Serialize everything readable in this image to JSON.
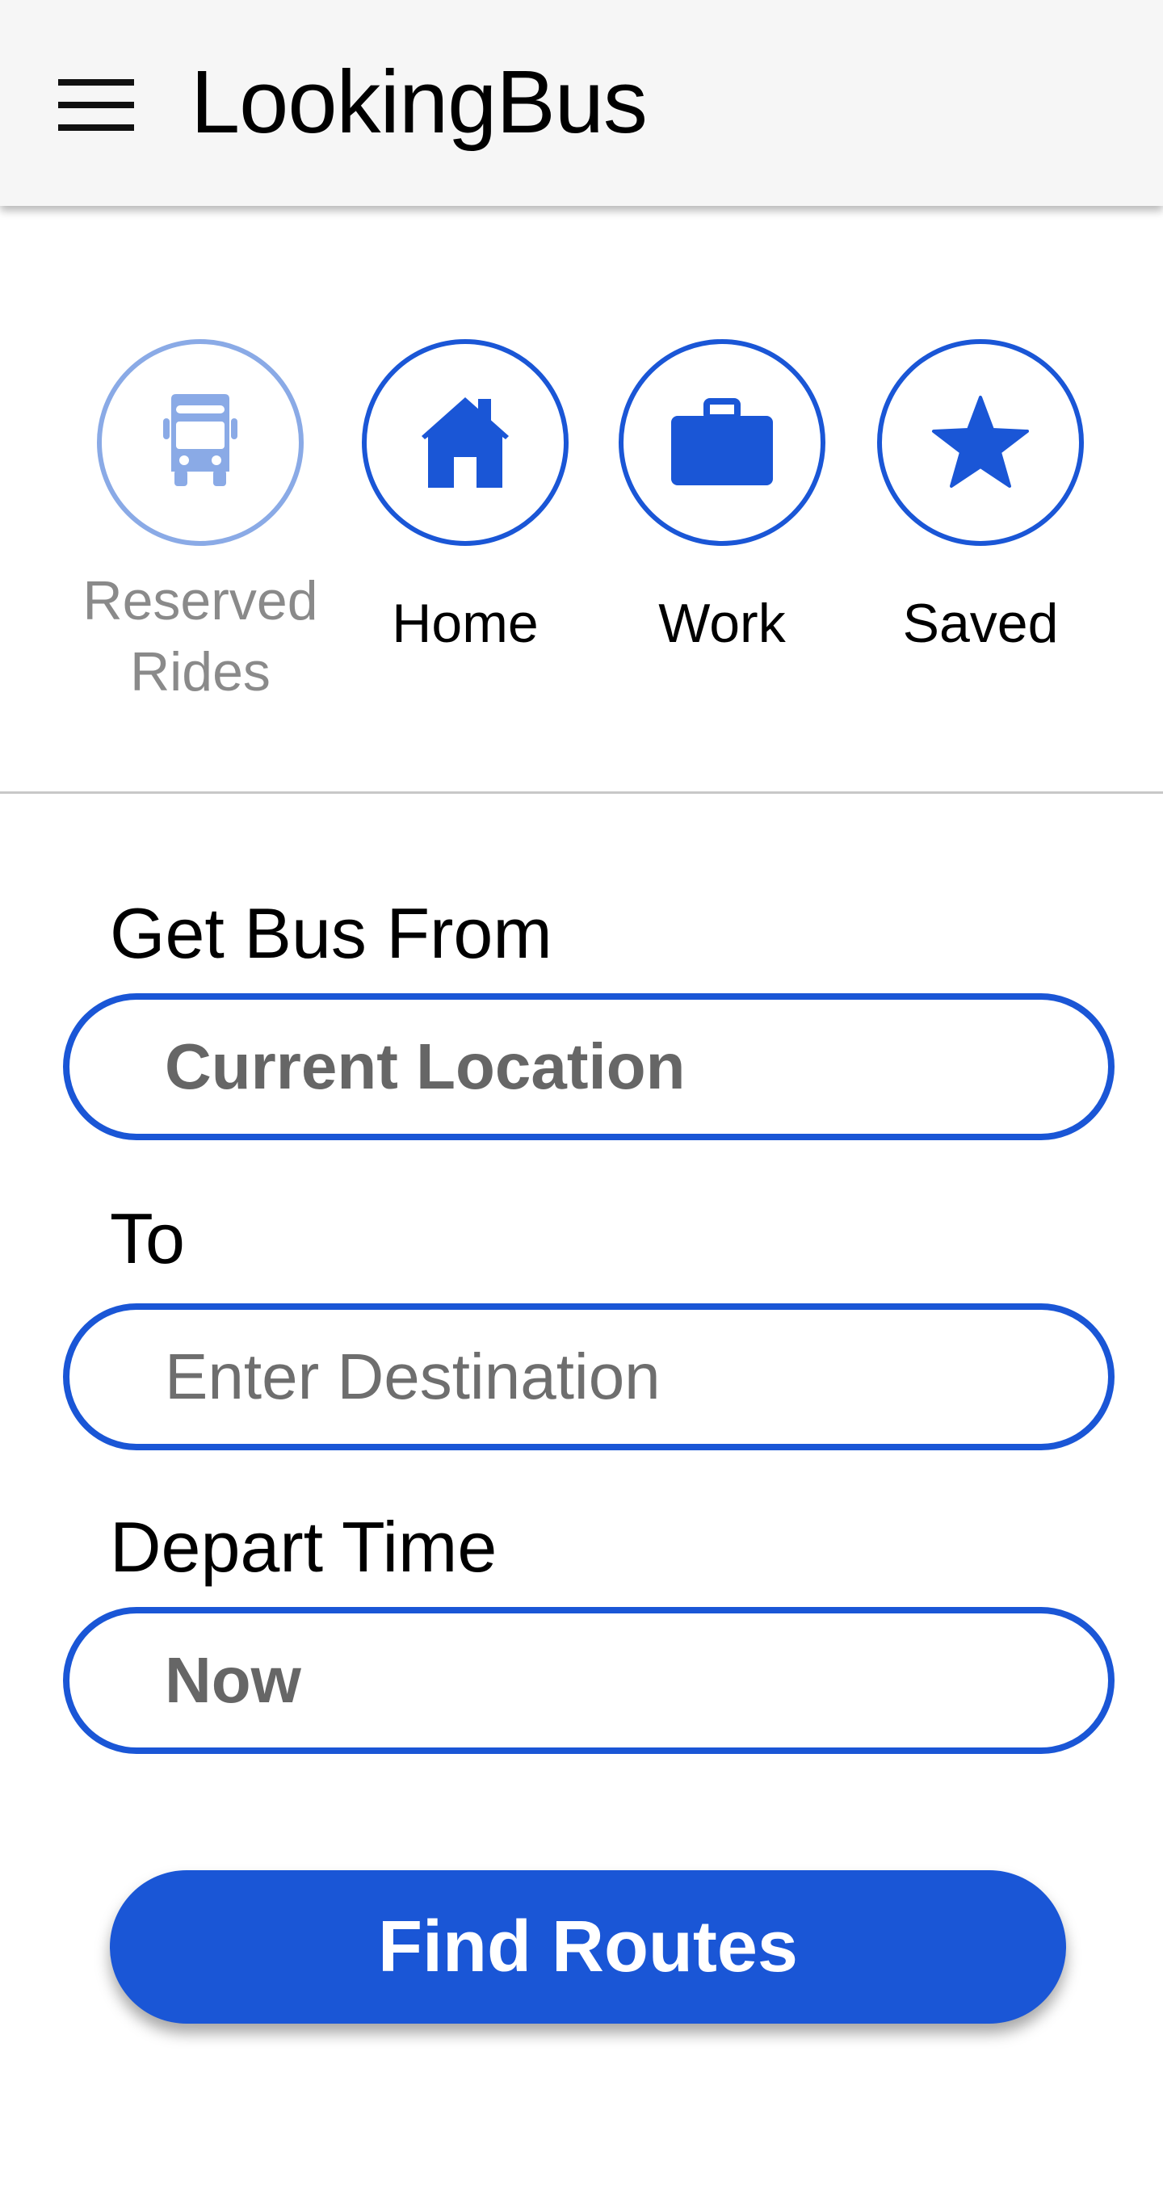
{
  "header": {
    "title": "LookingBus",
    "menu_icon": "hamburger-menu-icon"
  },
  "shortcuts": [
    {
      "label": "Reserved Rides",
      "icon": "bus-icon",
      "enabled": false
    },
    {
      "label": "Home",
      "icon": "home-icon",
      "enabled": true
    },
    {
      "label": "Work",
      "icon": "briefcase-icon",
      "enabled": true
    },
    {
      "label": "Saved",
      "icon": "star-icon",
      "enabled": true
    }
  ],
  "form": {
    "from": {
      "label": "Get Bus From",
      "value": "Current Location"
    },
    "to": {
      "label": "To",
      "value": "",
      "placeholder": "Enter Destination"
    },
    "depart": {
      "label": "Depart Time",
      "value": "Now"
    }
  },
  "actions": {
    "find_routes_label": "Find Routes"
  },
  "colors": {
    "accent": "#1a56d6",
    "accent_disabled": "#8aaae6",
    "header_bg": "#f6f6f6",
    "muted_text": "#8a8a8a"
  }
}
